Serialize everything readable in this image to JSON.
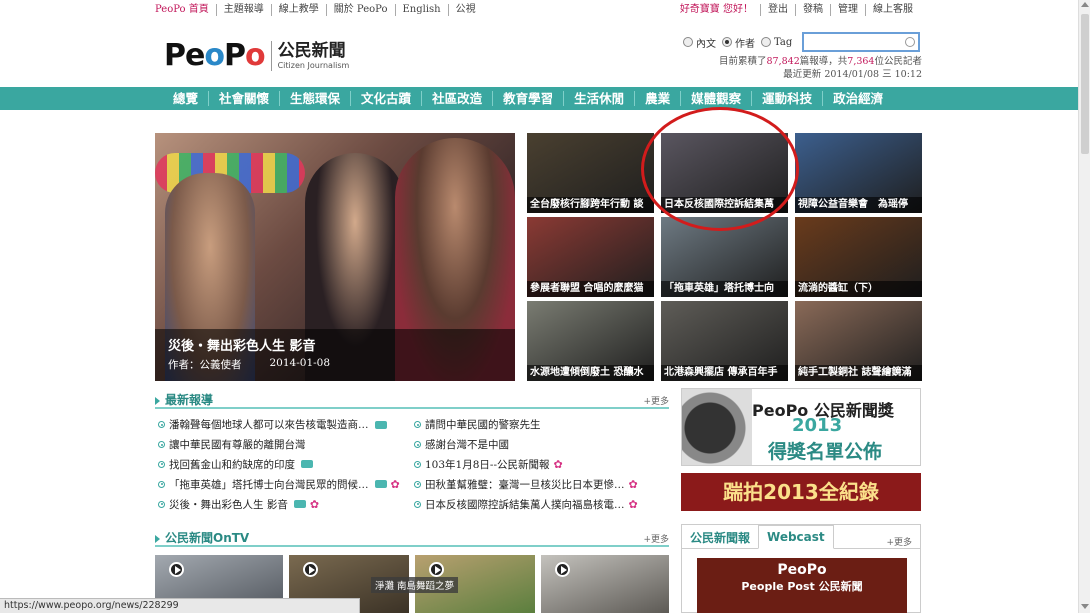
{
  "topbar": {
    "left_links": [
      "PeoPo 首頁",
      "主題報導",
      "線上教學",
      "關於 PeoPo",
      "English",
      "公視"
    ],
    "right_links": [
      "好奇寶寶 您好！",
      "登出",
      "發稿",
      "管理",
      "線上客服"
    ]
  },
  "header": {
    "logo_mark": "PeoPo",
    "logo_zh": "公民新聞",
    "logo_en": "Citizen Journalism",
    "search": {
      "options": [
        "內文",
        "作者",
        "Tag"
      ],
      "selected": "作者",
      "value": ""
    },
    "stats_line1_pre": "目前累積了",
    "stats_reports": "87,842",
    "stats_line1_mid": "篇報導，共",
    "stats_reporters": "7,364",
    "stats_line1_post": "位公民記者",
    "stats_line2": "最近更新 2014/01/08 三 10:12"
  },
  "nav": [
    "總覽",
    "社會關懷",
    "生態環保",
    "文化古蹟",
    "社區改造",
    "教育學習",
    "生活休閒",
    "農業",
    "媒體觀察",
    "運動科技",
    "政治經濟"
  ],
  "hero": {
    "title": "災後・舞出彩色人生 影音",
    "author": "作者：公義使者",
    "date": "2014-01-08"
  },
  "thumbs": [
    {
      "caption": "全台廢核行腳跨年行動 談",
      "color": "#4a4030"
    },
    {
      "caption": "日本反核國際控訴結集萬",
      "color": "#5a5660"
    },
    {
      "caption": "視障公益音樂會　為瑶停",
      "color": "#3c5f8e"
    },
    {
      "caption": "參展者聯盟 合唱的麼麼猫",
      "color": "#8b3a34"
    },
    {
      "caption": "「拖車英雄」塔托博士向",
      "color": "#6e7a83"
    },
    {
      "caption": "流淌的醬缸（下）",
      "color": "#6a3b1c"
    },
    {
      "caption": "水源地遭傾倒廢土 恐釀水",
      "color": "#7a7c72"
    },
    {
      "caption": "北港森興擺店 傳承百年手",
      "color": "#5f5d58"
    },
    {
      "caption": "純手工製銅社 誌聲繪鏡滿",
      "color": "#8a6a58"
    }
  ],
  "latest": {
    "title": "最新報導",
    "more": "+更多",
    "left": [
      {
        "text": "潘翰聲每個地球人都可以來告核電製造商…",
        "cam": true,
        "flower": false
      },
      {
        "text": "讓中華民國有尊嚴的離開台灣",
        "cam": false,
        "flower": false
      },
      {
        "text": "找回舊金山和約缺席的印度",
        "cam": true,
        "flower": false
      },
      {
        "text": "「拖車英雄」塔托博士向台灣民眾的問候…",
        "cam": true,
        "flower": true
      },
      {
        "text": "災後・舞出彩色人生 影音",
        "cam": true,
        "flower": true
      }
    ],
    "right": [
      {
        "text": "請問中華民國的警察先生",
        "cam": false,
        "flower": false
      },
      {
        "text": "感謝台灣不是中國",
        "cam": false,
        "flower": false
      },
      {
        "text": "103年1月8日--公民新聞報",
        "cam": false,
        "flower": true
      },
      {
        "text": "田秋堇幫雅璧：臺灣一旦核災比日本更慘…",
        "cam": false,
        "flower": true
      },
      {
        "text": "日本反核國際控訴結集萬人撲向福島核電…",
        "cam": false,
        "flower": true
      }
    ]
  },
  "ontv": {
    "title": "公民新聞OnTV",
    "more": "+更多",
    "overlay_label": "淨灘 南島舞蹈之夢"
  },
  "award": {
    "peopo": "PeoPo 公民新聞獎",
    "year": "2013",
    "subtitle": "得獎名單公佈",
    "record": "踹拍2013全紀錄"
  },
  "tabs": {
    "items": [
      "公民新聞報",
      "Webcast"
    ],
    "active": "Webcast",
    "more": "+更多",
    "post_line1": "PeoPo",
    "post_line2": "People Post 公民新聞"
  },
  "statusbar": "https://www.peopo.org/news/228299"
}
